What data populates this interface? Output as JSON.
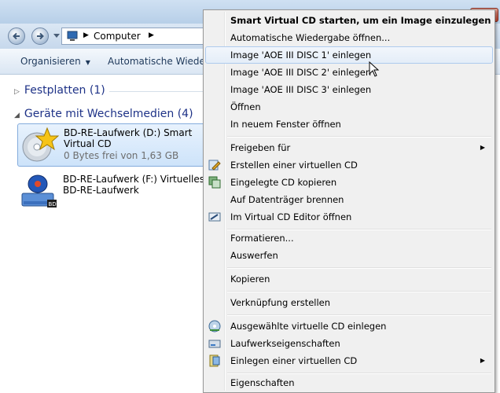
{
  "address": {
    "crumb": "Computer"
  },
  "toolbar": {
    "organize": "Organisieren",
    "autoplay": "Automatische Wiedergabe"
  },
  "groups": [
    {
      "label": "Festplatten (1)"
    },
    {
      "label": "Geräte mit Wechselmedien (4)"
    }
  ],
  "drives": [
    {
      "name": "BD-RE-Laufwerk (D:) Smart Virtual CD",
      "free": "0 Bytes frei von 1,63 GB",
      "icon": "cd-drive-star-icon"
    },
    {
      "name": "BD-RE-Laufwerk (F:) Virtuelles BD-RE-Laufwerk",
      "icon": "virtual-bd-drive-icon"
    }
  ],
  "menu": {
    "items": [
      {
        "label": "Smart Virtual CD starten, um ein Image einzulegen",
        "bold": true
      },
      {
        "label": "Automatische Wiedergabe öffnen..."
      },
      {
        "label": "Image 'AOE III DISC 1' einlegen",
        "hover": true
      },
      {
        "label": "Image 'AOE III DISC 2' einlegen"
      },
      {
        "label": "Image 'AOE III DISC 3' einlegen"
      },
      {
        "label": "Öffnen"
      },
      {
        "label": "In neuem Fenster öffnen"
      },
      {
        "label": "Freigeben für",
        "submenu": true
      },
      {
        "label": "Erstellen einer virtuellen CD",
        "icon": "create-virtual-cd-icon"
      },
      {
        "label": "Eingelegte CD kopieren",
        "icon": "copy-cd-icon"
      },
      {
        "label": "Auf Datenträger brennen"
      },
      {
        "label": "Im Virtual CD Editor öffnen",
        "icon": "cd-editor-icon"
      },
      {
        "label": "Formatieren..."
      },
      {
        "label": "Auswerfen"
      },
      {
        "label": "Kopieren"
      },
      {
        "label": "Verknüpfung erstellen"
      },
      {
        "label": "Ausgewählte virtuelle CD einlegen",
        "icon": "insert-virtual-cd-icon"
      },
      {
        "label": "Laufwerkseigenschaften",
        "icon": "drive-properties-icon"
      },
      {
        "label": "Einlegen einer virtuellen CD",
        "icon": "insert-cd-icon",
        "submenu": true
      },
      {
        "label": "Eigenschaften"
      }
    ]
  },
  "colors": {
    "group_heading": "#1e3287",
    "selection": "#cde3fa",
    "menu_bg": "#f0f0f0"
  }
}
